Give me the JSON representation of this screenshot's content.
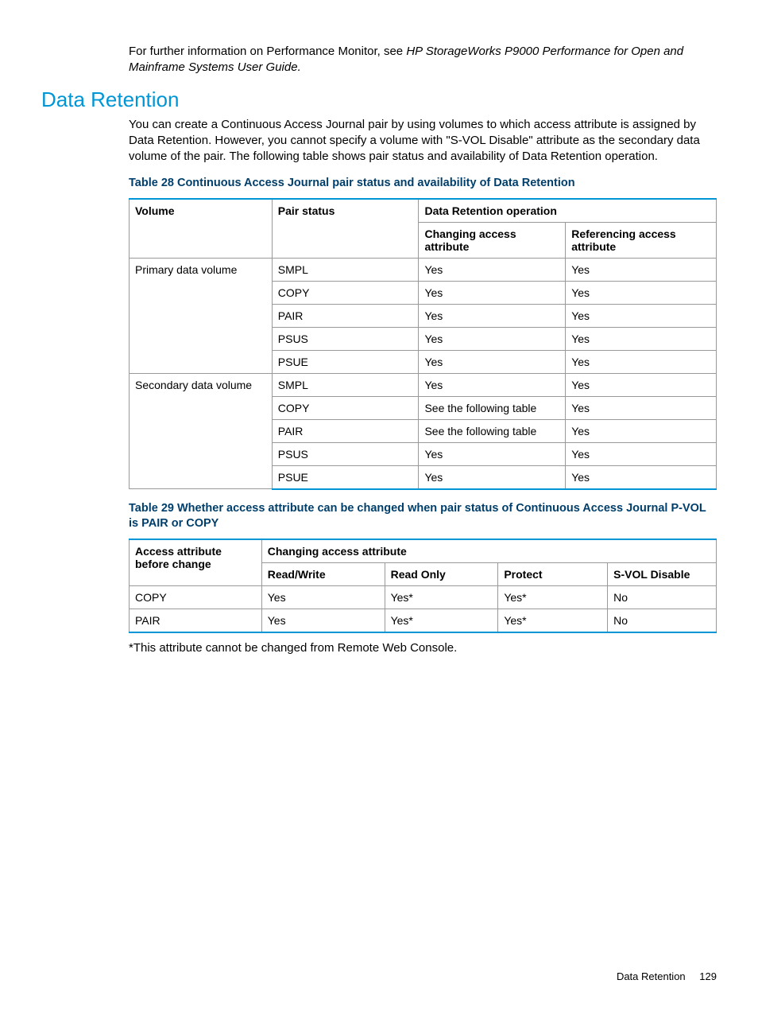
{
  "intro": {
    "line1_prefix": "For further information on Performance Monitor, see ",
    "line1_italic": "HP StorageWorks P9000 Performance for Open and Mainframe Systems User Guide.",
    "line1_suffix": ""
  },
  "section_heading": "Data Retention",
  "section_body": "You can create a Continuous Access Journal pair by using volumes to which access attribute is assigned by Data Retention. However, you cannot specify a volume with \"S-VOL Disable\" attribute as the secondary data volume of the pair. The following table shows pair status and availability of Data Retention operation.",
  "table28": {
    "caption": "Table 28 Continuous Access Journal pair status and availability of Data Retention",
    "headers": {
      "volume": "Volume",
      "pair_status": "Pair status",
      "operation": "Data Retention operation",
      "changing": "Changing access attribute",
      "referencing": "Referencing access attribute"
    },
    "groups": [
      {
        "volume": "Primary data volume",
        "rows": [
          {
            "status": "SMPL",
            "changing": "Yes",
            "referencing": "Yes"
          },
          {
            "status": "COPY",
            "changing": "Yes",
            "referencing": "Yes"
          },
          {
            "status": "PAIR",
            "changing": "Yes",
            "referencing": "Yes"
          },
          {
            "status": "PSUS",
            "changing": "Yes",
            "referencing": "Yes"
          },
          {
            "status": "PSUE",
            "changing": "Yes",
            "referencing": "Yes"
          }
        ]
      },
      {
        "volume": "Secondary data volume",
        "rows": [
          {
            "status": "SMPL",
            "changing": "Yes",
            "referencing": "Yes"
          },
          {
            "status": "COPY",
            "changing": "See the following table",
            "referencing": "Yes"
          },
          {
            "status": "PAIR",
            "changing": "See the following table",
            "referencing": "Yes"
          },
          {
            "status": "PSUS",
            "changing": "Yes",
            "referencing": "Yes"
          },
          {
            "status": "PSUE",
            "changing": "Yes",
            "referencing": "Yes"
          }
        ]
      }
    ]
  },
  "table29": {
    "caption": "Table 29 Whether access attribute can be changed when pair status of Continuous Access Journal P-VOL is PAIR or COPY",
    "headers": {
      "before": "Access attribute before change",
      "changing": "Changing access attribute",
      "rw": "Read/Write",
      "ro": "Read Only",
      "protect": "Protect",
      "svol": "S-VOL Disable"
    },
    "rows": [
      {
        "before": "COPY",
        "rw": "Yes",
        "ro": "Yes*",
        "protect": "Yes*",
        "svol": "No"
      },
      {
        "before": "PAIR",
        "rw": "Yes",
        "ro": "Yes*",
        "protect": "Yes*",
        "svol": "No"
      }
    ]
  },
  "footnote": "*This attribute cannot be changed from Remote Web Console.",
  "footer": {
    "label": "Data Retention",
    "page": "129"
  }
}
